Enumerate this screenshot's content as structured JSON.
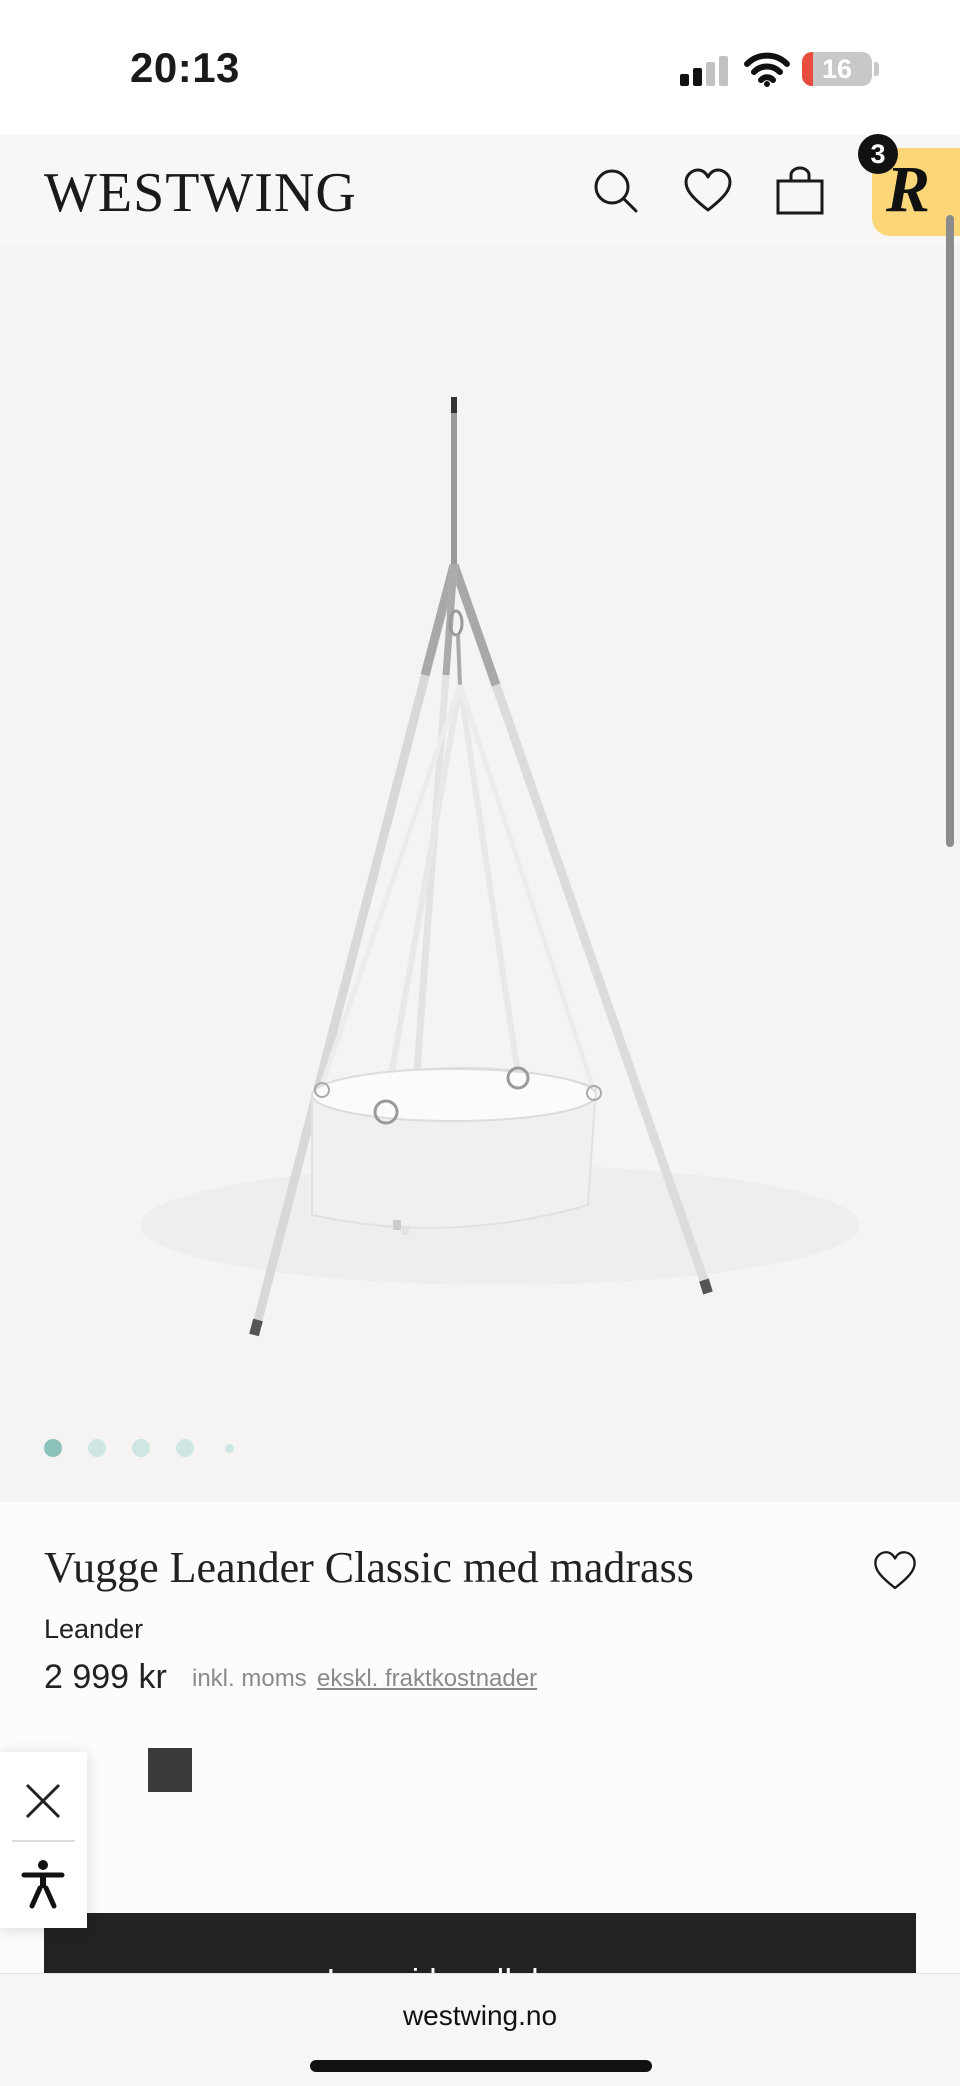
{
  "status_bar": {
    "time": "20:13",
    "battery_level": "16",
    "battery_fraction": 0.16,
    "icons": [
      "signal-icon",
      "wifi-icon",
      "battery-icon"
    ],
    "battery_color": "#e94b3c"
  },
  "header": {
    "logo": "WESTWING",
    "icons": [
      "search-icon",
      "heart-icon",
      "shopping-bag-icon",
      "more-icon"
    ]
  },
  "reward_badge": {
    "letter": "R",
    "count": "3",
    "color": "#fbd77a"
  },
  "gallery": {
    "image_description_icon": "cradle-image",
    "slide_count": 5,
    "active_slide": 1,
    "dot_active_color": "#8dc2ba",
    "dot_color": "#cfe7e3"
  },
  "product": {
    "title": "Vugge Leander Classic med madrass",
    "brand": "Leander",
    "price": "2 999 kr",
    "tax_note": "inkl. moms",
    "shipping_link": "ekskl. fraktkostnader",
    "swatch_color": "#3a3a3c"
  },
  "cart": {
    "button_label": "Legg i handlekurven"
  },
  "accessibility": {
    "icons": [
      "close-icon",
      "accessibility-icon"
    ]
  },
  "browser": {
    "url": "westwing.no"
  }
}
